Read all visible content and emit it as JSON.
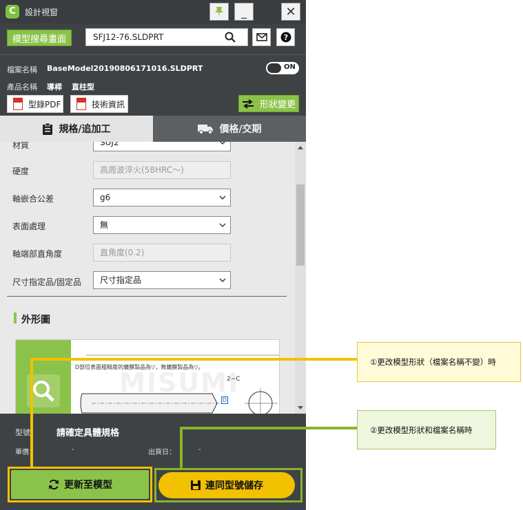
{
  "window": {
    "title": "設計視窗",
    "minimize": "_",
    "close": "✕"
  },
  "toolbar": {
    "search_page_button": "模型搜尋畫面",
    "search_value": "SFJ12-76.SLDPRT"
  },
  "info": {
    "file_label": "檔案名稱",
    "file_value": "BaseModel20190806171016.SLDPRT",
    "toggle_state": "ON",
    "product_label": "產品名稱",
    "product_category": "導桿",
    "product_type": "直柱型",
    "catalog_pdf": "型錄PDF",
    "tech_info": "技術資訊",
    "change_shape": "形狀變更"
  },
  "tabs": {
    "spec": "規格/追加工",
    "price": "價格/交期"
  },
  "spec_rows": [
    {
      "label": "材質",
      "value": "SUJ2",
      "disabled": false
    },
    {
      "label": "硬度",
      "value": "高周波淬火(58HRC〜)",
      "disabled": true
    },
    {
      "label": "軸嵌合公差",
      "value": "g6",
      "disabled": false
    },
    {
      "label": "表面處理",
      "value": "無",
      "disabled": false
    },
    {
      "label": "軸端部直角度",
      "value": "直角度(0.2)",
      "disabled": true
    },
    {
      "label": "尺寸指定品/固定品",
      "value": "尺寸指定品",
      "disabled": false
    }
  ],
  "section": {
    "title": "外形圖"
  },
  "figure": {
    "note": "D部位表面粗糙度的鍍膜製品為▽，無鍍膜製品為▽。",
    "dim_label": "2−C",
    "d_label": "D",
    "watermark": "MISUMI"
  },
  "footer": {
    "model_label": "型號：",
    "model_value": "請確定具體規格",
    "price_label": "單價：",
    "price_value": "-",
    "ship_label": "出貨日：",
    "ship_value": "-",
    "update_button": "更新至模型",
    "save_button": "連同型號儲存"
  },
  "callouts": {
    "yellow": "①更改模型形狀（檔案名稱不變）時",
    "green": "②更改模型形狀和檔案名稱時"
  },
  "colors": {
    "accent_green": "#8bc34a",
    "accent_yellow": "#f2c100",
    "panel_dark": "#3f4245"
  }
}
